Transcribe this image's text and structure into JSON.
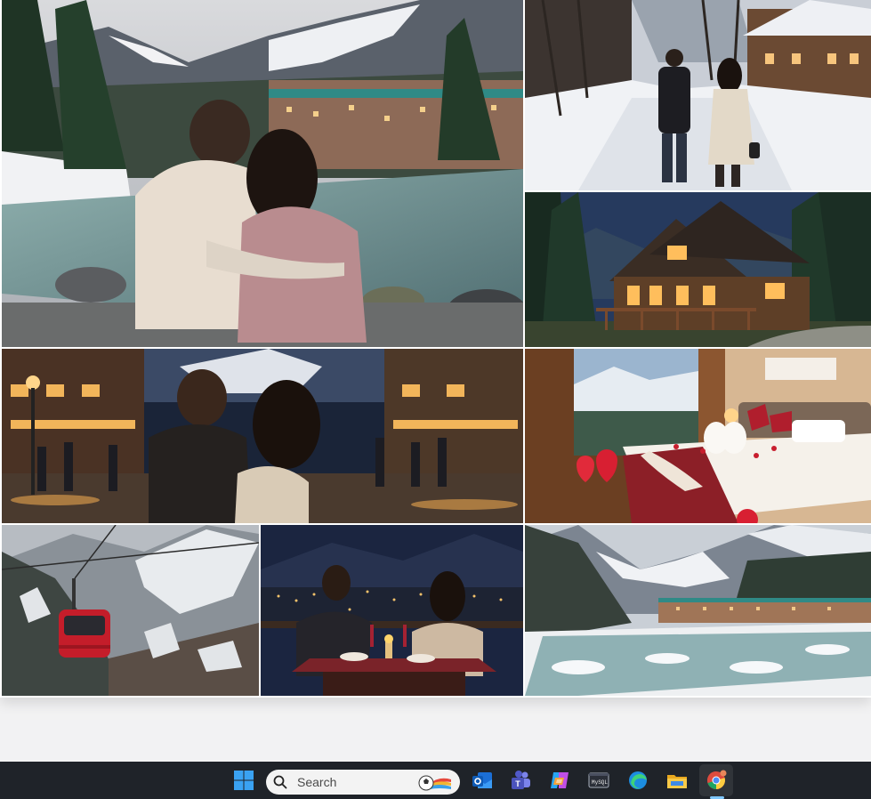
{
  "taskbar": {
    "search": {
      "placeholder": "Search"
    },
    "icons": [
      {
        "name": "windows-start-icon"
      },
      {
        "name": "outlook-icon"
      },
      {
        "name": "teams-icon"
      },
      {
        "name": "copilot-icon"
      },
      {
        "name": "terminal-icon"
      },
      {
        "name": "edge-icon"
      },
      {
        "name": "file-explorer-icon"
      },
      {
        "name": "chrome-icon"
      }
    ],
    "active_app": "chrome",
    "colors": {
      "background": "#1f2329",
      "active_indicator": "#7fc8ff"
    }
  },
  "collage": {
    "tiles": [
      {
        "name": "couple-by-river-photo"
      },
      {
        "name": "couple-walking-snow-photo"
      },
      {
        "name": "wooden-cottage-night-photo"
      },
      {
        "name": "couple-street-night-photo"
      },
      {
        "name": "decorated-honeymoon-bed-photo"
      },
      {
        "name": "cable-car-photo"
      },
      {
        "name": "candlelight-dinner-photo"
      },
      {
        "name": "snowy-valley-river-photo"
      }
    ]
  }
}
